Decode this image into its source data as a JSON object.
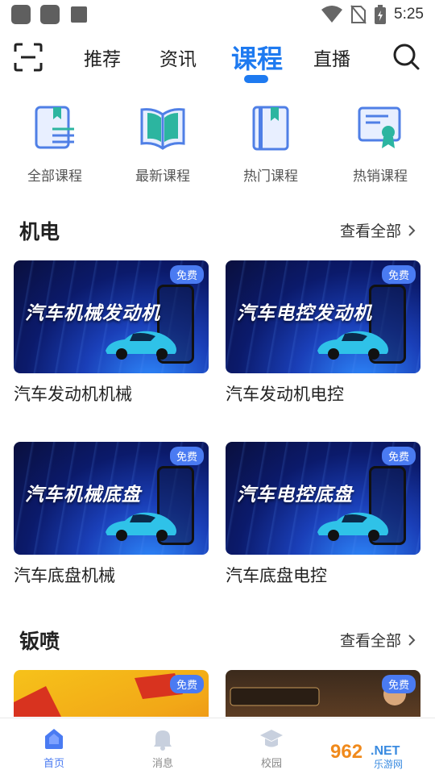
{
  "status_bar": {
    "time": "5:25"
  },
  "top_nav": {
    "tabs": [
      {
        "label": "推荐"
      },
      {
        "label": "资讯"
      },
      {
        "label": "课程",
        "active": true
      },
      {
        "label": "直播"
      }
    ],
    "scan_icon": "scan-icon",
    "search_icon": "search-icon"
  },
  "categories": [
    {
      "label": "全部课程",
      "icon": "book-list-icon"
    },
    {
      "label": "最新课程",
      "icon": "open-book-icon"
    },
    {
      "label": "热门课程",
      "icon": "bookmark-book-icon"
    },
    {
      "label": "热销课程",
      "icon": "certificate-icon"
    }
  ],
  "sections": [
    {
      "title": "机电",
      "more_label": "查看全部",
      "cards": [
        {
          "thumb_text": "汽车机械发动机",
          "badge": "免费",
          "title": "汽车发动机机械"
        },
        {
          "thumb_text": "汽车电控发动机",
          "badge": "免费",
          "title": "汽车发动机电控"
        },
        {
          "thumb_text": "汽车机械底盘",
          "badge": "免费",
          "title": "汽车底盘机械"
        },
        {
          "thumb_text": "汽车电控底盘",
          "badge": "免费",
          "title": "汽车底盘电控"
        }
      ]
    },
    {
      "title": "钣喷",
      "more_label": "查看全部",
      "cards": [
        {
          "badge": "免费"
        },
        {
          "badge": "免费"
        }
      ]
    }
  ],
  "bottom_nav": [
    {
      "label": "首页",
      "icon": "home-icon",
      "active": true
    },
    {
      "label": "消息",
      "icon": "bell-icon"
    },
    {
      "label": "校园",
      "icon": "graduation-cap-icon"
    }
  ],
  "colors": {
    "accent": "#1e7af0",
    "badge": "#4a7bf2",
    "icon_blue": "#4f7fe6"
  }
}
